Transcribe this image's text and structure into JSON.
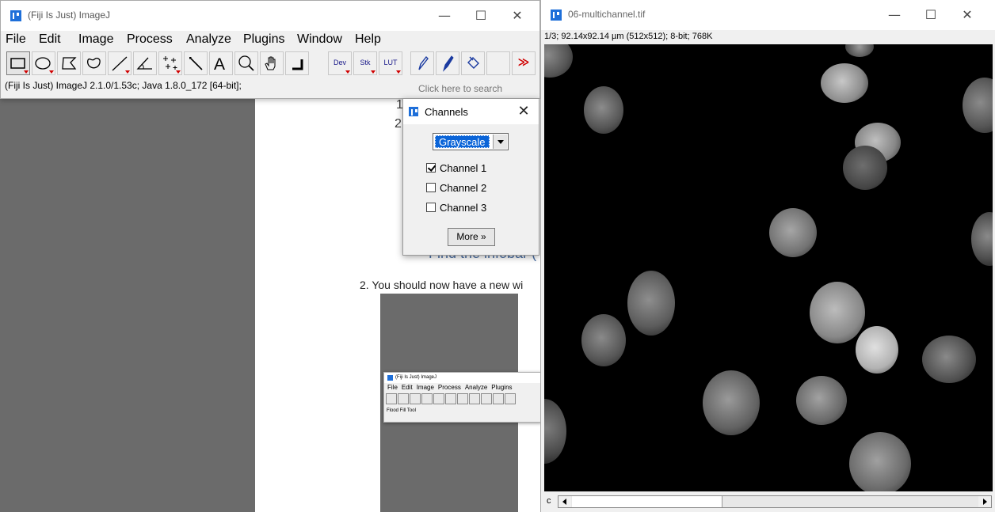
{
  "imagej": {
    "title": "(Fiji Is Just) ImageJ",
    "menus": [
      "File",
      "Edit",
      "Image",
      "Process",
      "Analyze",
      "Plugins",
      "Window",
      "Help"
    ],
    "tools": [
      "rectangle",
      "oval",
      "polygon",
      "freehand",
      "line",
      "angle",
      "multipoint",
      "wand",
      "text",
      "magnifier",
      "hand",
      "color-picker"
    ],
    "tool_labels": {
      "dev": "Dev",
      "stk": "Stk",
      "lut": "LUT"
    },
    "more_tools": "≫",
    "status": "(Fiji Is Just) ImageJ 2.1.0/1.53c; Java 1.8.0_172 [64-bit];",
    "search_placeholder": "Click here to search"
  },
  "window_controls": {
    "minimize": "—",
    "maximize": "☐",
    "close": "✕"
  },
  "channels": {
    "title": "Channels",
    "mode": "Grayscale",
    "items": [
      {
        "label": "Channel 1",
        "checked": true
      },
      {
        "label": "Channel 2",
        "checked": false
      },
      {
        "label": "Channel 3",
        "checked": false
      }
    ],
    "more": "More »"
  },
  "document": {
    "num1": "1.",
    "num2": "2.",
    "bullet": "- Find the infobar (",
    "step2": "2.   You should now have a new wi",
    "mini_title": "(Fiji Is Just) ImageJ",
    "mini_menus": [
      "File",
      "Edit",
      "Image",
      "Process",
      "Analyze",
      "Plugins"
    ],
    "mini_status": "Flood Fill Tool"
  },
  "image_window": {
    "title": "06-multichannel.tif",
    "info": "1/3; 92.14x92.14 µm (512x512); 8-bit; 768K",
    "slider_label": "c"
  },
  "colors": {
    "accent": "#0a64d8",
    "logo": "#1e6fd9",
    "background_gray": "#6b6b6b"
  }
}
